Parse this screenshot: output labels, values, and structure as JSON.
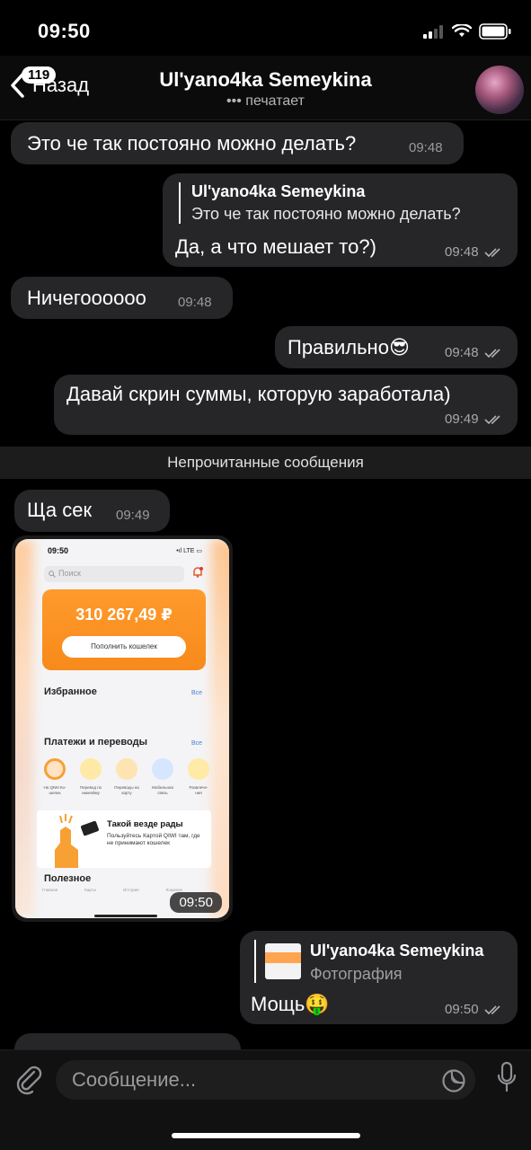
{
  "status_bar": {
    "time": "09:50"
  },
  "header": {
    "back_label": "Назад",
    "unread_count": "119",
    "title": "Ul'yano4ka Semeykina",
    "status": "••• печатает"
  },
  "messages": [
    {
      "text": "Это че так постояно можно делать?",
      "time": "09:48"
    },
    {
      "reply_name": "Ul'yano4ka Semeykina",
      "reply_text": "Это че так постояно можно делать?",
      "text": "Да, а что мешает то?)",
      "time": "09:48"
    },
    {
      "text": "Ничегоооооо",
      "time": "09:48"
    },
    {
      "text": "Правильно😎",
      "time": "09:48"
    },
    {
      "text": "Давай скрин суммы, которую заработала)",
      "time": "09:49"
    },
    {
      "text": "Ща сек",
      "time": "09:49"
    },
    {
      "time": "09:50"
    },
    {
      "reply_name": "Ul'yano4ka Semeykina",
      "reply_text": "Фотография",
      "text": "Мощь🤑",
      "time": "09:50"
    }
  ],
  "unread_divider": "Непрочитанные сообщения",
  "photo": {
    "status_time": "09:50",
    "status_icons": "•ıl LTE ▭",
    "search": "Поиск",
    "balance": "310 267,49 ₽",
    "topup_button": "Пополнить кошелек",
    "favorites": "Избранное",
    "all": "Все",
    "payments": "Платежи и переводы",
    "services": [
      {
        "label": "На QIWI Ко-шелек",
        "color": "#ffe3c4"
      },
      {
        "label": "Перевод по никнейму",
        "color": "#ffe9a6"
      },
      {
        "label": "Переводы на карту",
        "color": "#ffe3b0"
      },
      {
        "label": "Мобильная связь",
        "color": "#d6e6ff"
      },
      {
        "label": "Развлече-ния",
        "color": "#ffeaa6"
      }
    ],
    "promo_title": "Такой везде рады",
    "promo_text": "Пользуйтесь Картой QIWI там, где не принимают кошелек",
    "useful": "Полезное",
    "tabs": [
      "Главная",
      "Карты",
      "История",
      "Кошелек",
      ""
    ]
  },
  "input": {
    "placeholder": "Сообщение..."
  },
  "colors": {
    "incoming_bubble": "#262628",
    "background": "#000000",
    "accent_orange": "#ff9a2c"
  }
}
